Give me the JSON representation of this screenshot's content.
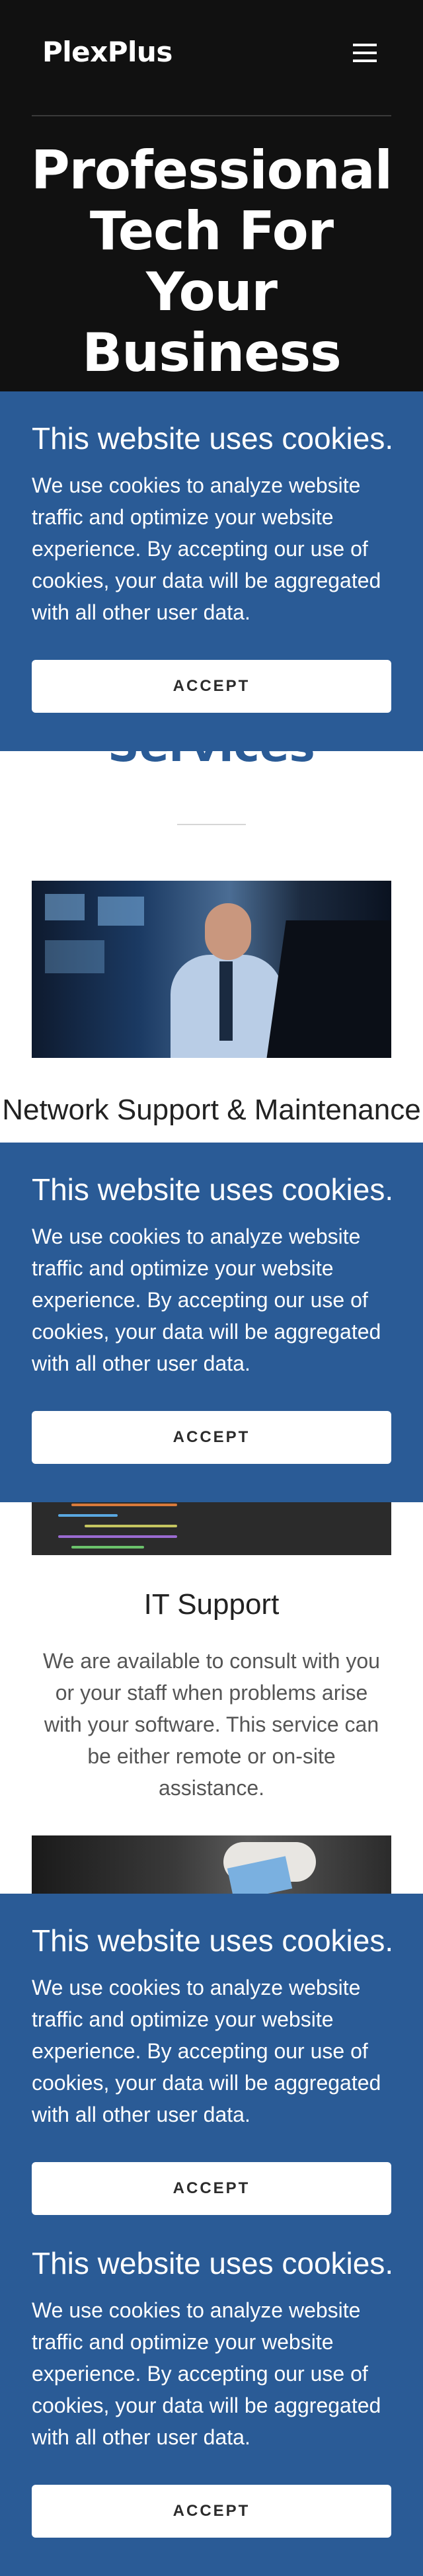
{
  "header": {
    "brand": "PlexPlus",
    "menu_icon": "hamburger-menu-icon"
  },
  "hero": {
    "title_lines": [
      "Professional",
      "Tech For",
      "Your",
      "Business"
    ]
  },
  "services": {
    "heading": "Services",
    "items": [
      {
        "title": "Network Support & Maintenance",
        "image": "technician-at-computer-photo"
      },
      {
        "title": "IT Support",
        "description": "We are available to consult with you or your staff when problems arise with your software. This service can be either remote or on-site assistance.",
        "image": "code-on-screen-photo"
      },
      {
        "title": "",
        "image": "robot-arm-tablet-photo"
      }
    ]
  },
  "cookie": {
    "title": "This website uses cookies.",
    "text": "We use cookies to analyze website traffic and optimize your website experience. By accepting our use of cookies, your data will be aggregated with all other user data.",
    "accept_label": "ACCEPT"
  },
  "colors": {
    "hero_bg": "#111111",
    "accent": "#2a5b96",
    "banner_bg": "#2a5b96",
    "button_bg": "#ffffff"
  }
}
